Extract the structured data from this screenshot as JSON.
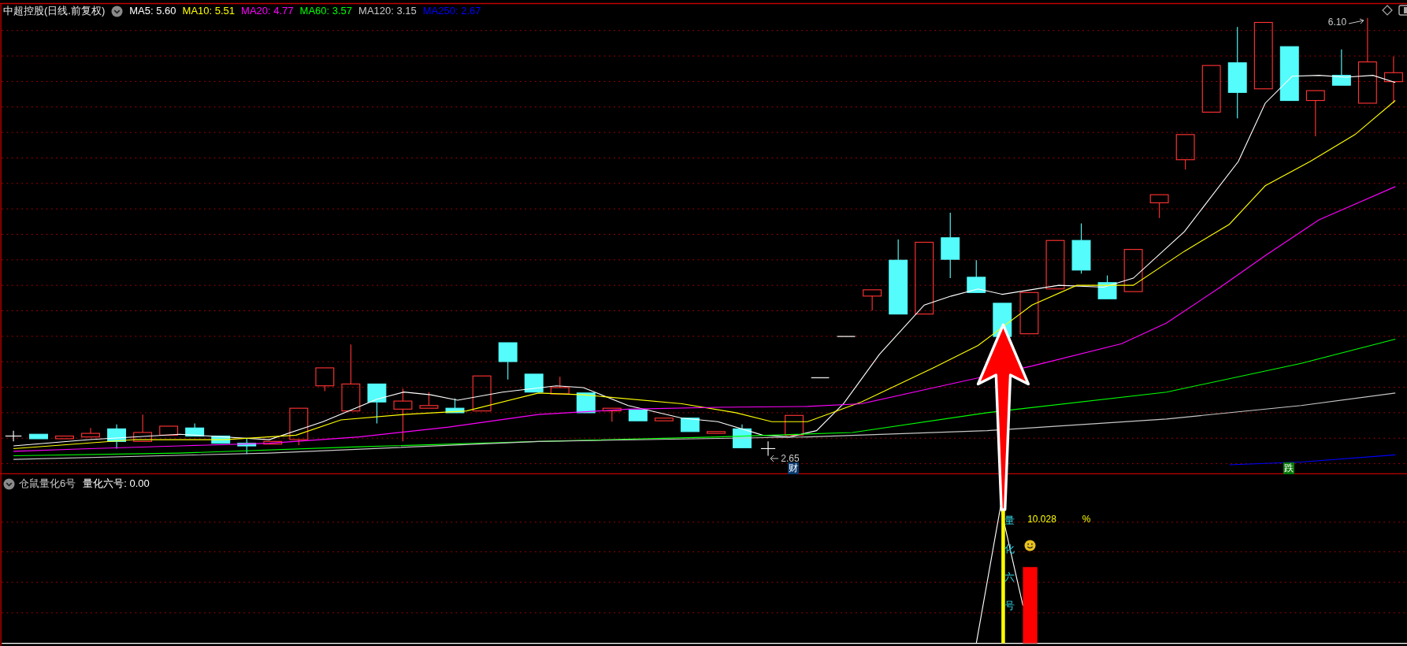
{
  "header": {
    "title": "中超控股(日线.前复权)",
    "ma_legend": [
      {
        "label": "MA5: 5.60",
        "color": "#ffffff"
      },
      {
        "label": "MA10: 5.51",
        "color": "#ffff00"
      },
      {
        "label": "MA20: 4.77",
        "color": "#ff00ff"
      },
      {
        "label": "MA60: 3.57",
        "color": "#00ff00"
      },
      {
        "label": "MA120: 3.15",
        "color": "#c8c8c8"
      },
      {
        "label": "MA250: 2.67",
        "color": "#0000ff"
      }
    ]
  },
  "price_labels": {
    "high": "6.10",
    "low": "2.65"
  },
  "signal_tags": [
    {
      "text": "财",
      "color": "#0b3a6e"
    },
    {
      "text": "跌",
      "color": "#0a7a0a"
    }
  ],
  "indicator": {
    "name": "仓鼠量化6号",
    "reading": "量化六号: 0.00",
    "vertical_label": "量化六号",
    "value": "10.028",
    "unit": "%"
  }
}
